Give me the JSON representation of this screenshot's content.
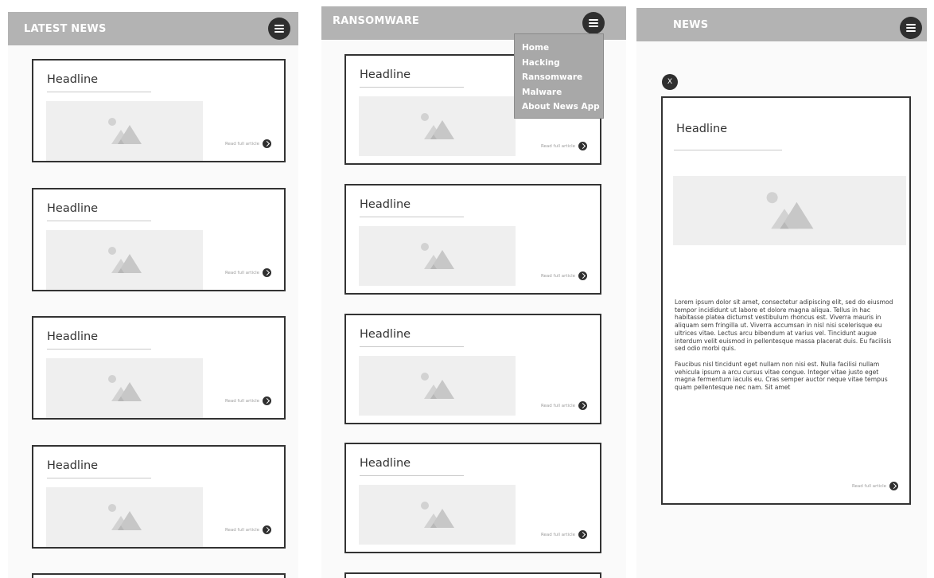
{
  "screens": [
    {
      "title": "LATEST NEWS",
      "cards": [
        {
          "headline": "Headline",
          "read_more": "Read full article"
        },
        {
          "headline": "Headline",
          "read_more": "Read full article"
        },
        {
          "headline": "Headline",
          "read_more": "Read full article"
        },
        {
          "headline": "Headline",
          "read_more": "Read full article"
        }
      ]
    },
    {
      "title": "RANSOMWARE",
      "menu": [
        "Home",
        "Hacking",
        "Ransomware",
        "Malware",
        "About News App"
      ],
      "cards": [
        {
          "headline": "Headline",
          "read_more": "Read full article"
        },
        {
          "headline": "Headline",
          "read_more": "Read full article"
        },
        {
          "headline": "Headline",
          "read_more": "Read full article"
        },
        {
          "headline": "Headline",
          "read_more": "Read full article"
        }
      ]
    },
    {
      "title": "NEWS",
      "close_label": "X",
      "article": {
        "headline": "Headline",
        "paragraphs": [
          "Lorem ipsum dolor sit amet, consectetur adipiscing elit, sed do eiusmod tempor incididunt ut labore et dolore magna aliqua. Tellus in hac habitasse platea dictumst vestibulum rhoncus est. Viverra mauris in aliquam sem fringilla ut. Viverra accumsan in nisl nisi scelerisque eu ultrices vitae. Lectus arcu bibendum at varius vel. Tincidunt augue interdum velit euismod in pellentesque massa placerat duis. Eu facilisis sed odio morbi quis.",
          "Faucibus nisl tincidunt eget nullam non nisi est. Nulla facilisi nullam vehicula ipsum a arcu cursus vitae congue. Integer vitae justo eget magna fermentum iaculis eu. Cras semper auctor neque vitae tempus quam pellentesque nec nam. Sit amet"
        ],
        "read_more": "Read full article"
      }
    }
  ],
  "icons": {
    "menu": "hamburger-menu-icon",
    "image_placeholder": "image-placeholder-icon",
    "arrow": "arrow-right-icon",
    "close": "close-icon"
  },
  "colors": {
    "appbar": "#b3b3b3",
    "dropdown": "#a8a8a8",
    "dark": "#2f2f2f",
    "placeholder": "#efefef"
  }
}
